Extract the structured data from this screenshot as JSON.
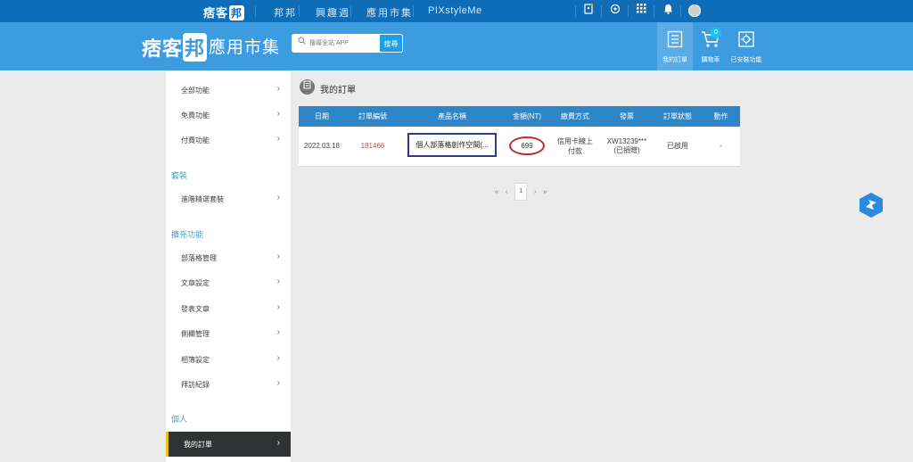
{
  "topbar": {
    "logo": "痞客",
    "logo_mark": "邦",
    "nav": [
      "邦邦",
      "興趣週",
      "應用市集",
      "PIXstyleMe"
    ],
    "icons": [
      "bookmark-icon",
      "search-icon",
      "apps-grid-icon",
      "bell-icon",
      "avatar"
    ]
  },
  "header": {
    "brand": "痞客",
    "brand_mark": "邦",
    "brand_sub": "應用市集",
    "search_placeholder": "搜尋全站 APP",
    "search_button": "搜尋",
    "items": [
      {
        "label": "我的訂單",
        "icon": "order-list-icon"
      },
      {
        "label": "購物車",
        "icon": "cart-icon",
        "badge": "0"
      },
      {
        "label": "已安裝功能",
        "icon": "installed-apps-icon"
      }
    ]
  },
  "sidebar": {
    "group1": [
      "全部功能",
      "免費功能",
      "付費功能"
    ],
    "section_package": "套裝",
    "package_items": [
      "進階精選套裝"
    ],
    "section_ext": "擴充功能",
    "ext_items": [
      "部落格管理",
      "文章設定",
      "發表文章",
      "側欄管理",
      "相簿設定",
      "拜訪紀錄"
    ],
    "section_personal": "個人",
    "personal_items": [
      "我的訂單"
    ]
  },
  "page": {
    "title": "我的訂單"
  },
  "orders": {
    "headers": [
      "日期",
      "訂單編號",
      "產品名稱",
      "金額(NT)",
      "繳費方式",
      "發票",
      "訂單狀態",
      "動作"
    ],
    "rows": [
      {
        "date": "2022.03.18",
        "order_no": "181466",
        "product": "個人部落格創作空間(...",
        "amount": "699",
        "payment": [
          "信用卡線上",
          "付款"
        ],
        "invoice": [
          "XW13239***",
          "(已捐贈)"
        ],
        "status": "已啟用",
        "action": "-"
      }
    ]
  },
  "pager": {
    "first": "«",
    "prev": "‹",
    "current": "1",
    "next": "›",
    "last": "»"
  },
  "colors": {
    "topbar": "#0f6db8",
    "header": "#3d9be0",
    "table_header": "#2e85c7",
    "order_no": "#c0504d",
    "highlight_box": "#2b3a8f",
    "highlight_circle": "#c8272e",
    "active_marker": "#e8c21c"
  }
}
